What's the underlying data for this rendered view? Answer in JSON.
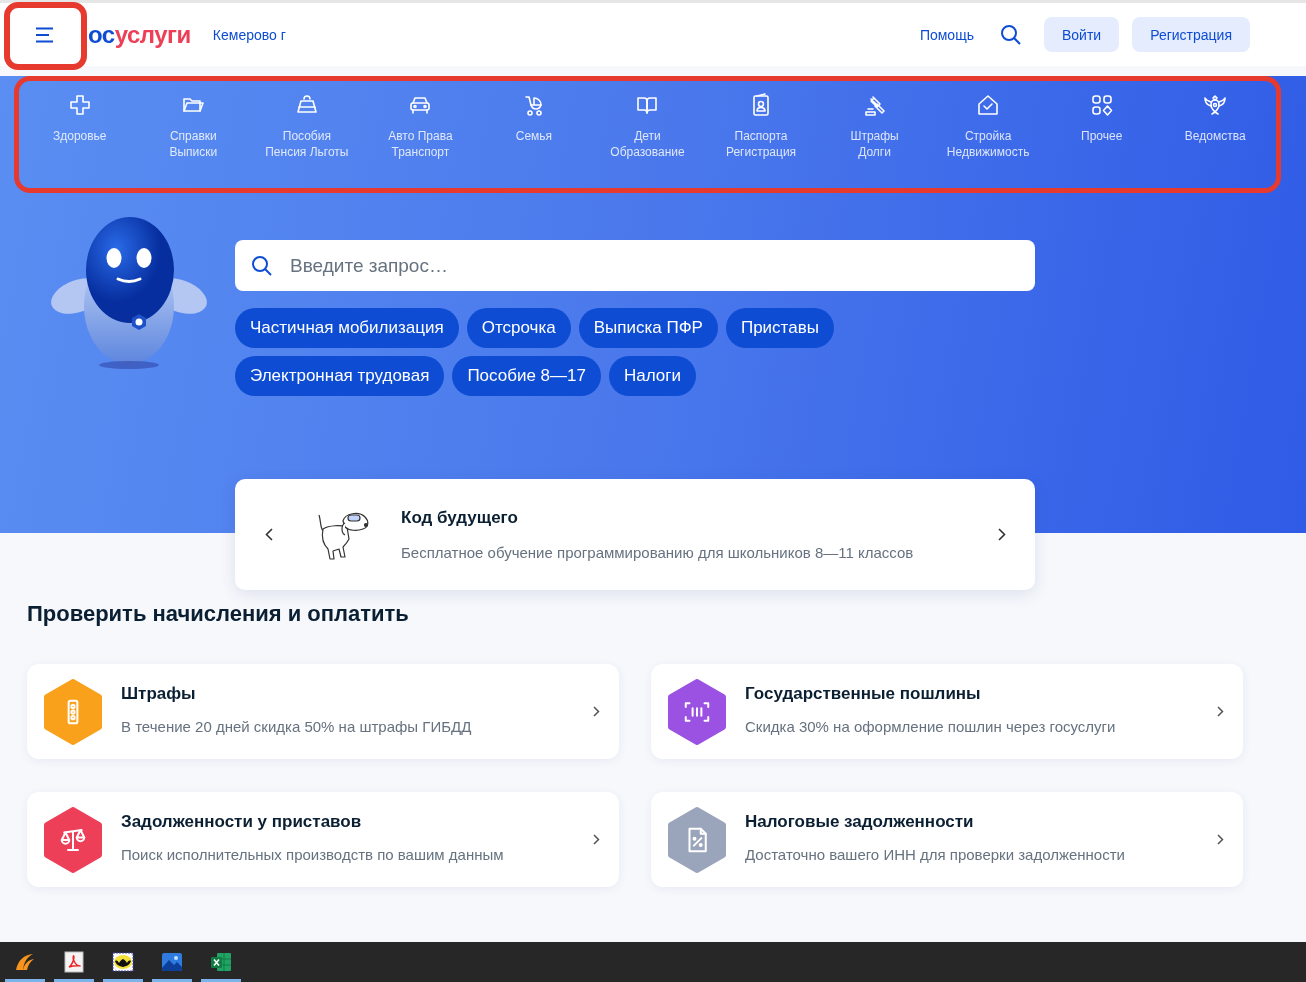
{
  "header": {
    "logo": [
      "ос",
      "услуги"
    ],
    "city": "Кемерово г",
    "help": "Помощь",
    "login": "Войти",
    "register": "Регистрация"
  },
  "categories": [
    {
      "kind": "health",
      "lines": [
        "Здоровье"
      ]
    },
    {
      "kind": "folder",
      "lines": [
        "Справки",
        "Выписки"
      ]
    },
    {
      "kind": "purse",
      "lines": [
        "Пособия",
        "Пенсия Льготы"
      ]
    },
    {
      "kind": "car",
      "lines": [
        "Авто Права",
        "Транспорт"
      ]
    },
    {
      "kind": "stroller",
      "lines": [
        "Семья"
      ]
    },
    {
      "kind": "book",
      "lines": [
        "Дети",
        "Образование"
      ]
    },
    {
      "kind": "passport",
      "lines": [
        "Паспорта",
        "Регистрация"
      ]
    },
    {
      "kind": "gavel",
      "lines": [
        "Штрафы",
        "Долги"
      ]
    },
    {
      "kind": "house",
      "lines": [
        "Стройка",
        "Недвижимость"
      ]
    },
    {
      "kind": "grid",
      "lines": [
        "Прочее"
      ]
    },
    {
      "kind": "emblem",
      "lines": [
        "Ведомства"
      ]
    }
  ],
  "search": {
    "placeholder": "Введите запрос…"
  },
  "quick_links": [
    "Частичная мобилизация",
    "Отсрочка",
    "Выписка ПФР",
    "Приставы",
    "Электронная трудовая",
    "Пособие 8—17",
    "Налоги"
  ],
  "promo": {
    "title": "Код будущего",
    "text": "Бесплатное обучение программированию для школьников 8—11 классов"
  },
  "payments": {
    "title": "Проверить начисления и оплатить",
    "cards": [
      {
        "kind": "traffic",
        "color": "#f9a11b",
        "title": "Штрафы",
        "text": "В течение 20 дней скидка 50% на штрафы ГИБДД"
      },
      {
        "kind": "scan",
        "color": "#9b52e3",
        "title": "Государственные пошлины",
        "text": "Скидка 30% на оформление пошлин через госуслуги"
      },
      {
        "kind": "scales",
        "color": "#ee3f58",
        "title": "Задолженности у приставов",
        "text": "Поиск исполнительных производств по вашим данным"
      },
      {
        "kind": "taxdoc",
        "color": "#9aa5bb",
        "title": "Налоговые задолженности",
        "text": "Достаточно вашего ИНН для проверки задолженности"
      }
    ]
  },
  "taskbar": {
    "apps": [
      {
        "kind": "swoosh",
        "running": true
      },
      {
        "kind": "pdf",
        "running": true
      },
      {
        "kind": "bat",
        "running": true
      },
      {
        "kind": "photos",
        "running": true
      },
      {
        "kind": "sheet",
        "running": true
      }
    ]
  }
}
